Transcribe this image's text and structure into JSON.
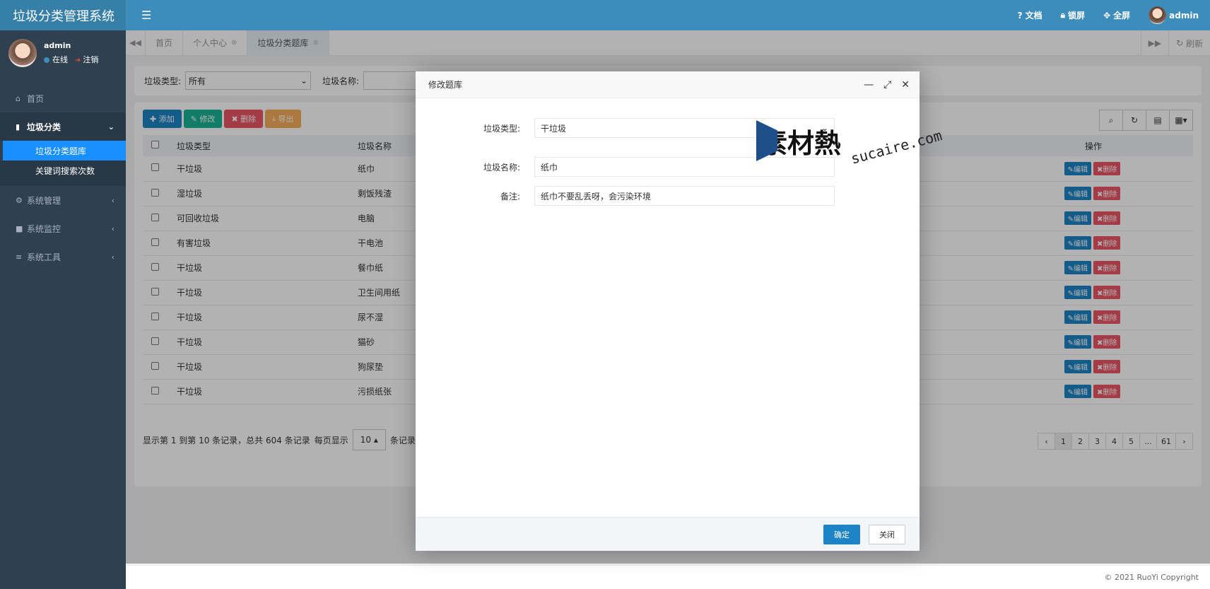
{
  "app": {
    "title": "垃圾分类管理系统"
  },
  "topbar": {
    "docs": "文档",
    "lock": "锁屏",
    "fullscreen": "全屏",
    "username": "admin"
  },
  "user_panel": {
    "name": "admin",
    "online": "在线",
    "logout": "注销"
  },
  "sidebar": {
    "home": "首页",
    "garbage": "垃圾分类",
    "garbage_library": "垃圾分类题库",
    "keyword_stats": "关键词搜索次数",
    "system_manage": "系统管理",
    "system_monitor": "系统监控",
    "system_tools": "系统工具"
  },
  "tabs": {
    "home": "首页",
    "profile": "个人中心",
    "library": "垃圾分类题库",
    "refresh": "刷新"
  },
  "search": {
    "type_label": "垃圾类型:",
    "type_value": "所有",
    "name_label": "垃圾名称:"
  },
  "toolbar": {
    "add": "添加",
    "edit": "修改",
    "delete": "删除",
    "export": "导出"
  },
  "table": {
    "headers": {
      "type": "垃圾类型",
      "name": "垃圾名称",
      "ops": "操作"
    },
    "edit_label": "编辑",
    "delete_label": "删除",
    "rows": [
      {
        "type": "干垃圾",
        "name": "纸巾"
      },
      {
        "type": "湿垃圾",
        "name": "剩饭残渣"
      },
      {
        "type": "可回收垃圾",
        "name": "电脑"
      },
      {
        "type": "有害垃圾",
        "name": "干电池"
      },
      {
        "type": "干垃圾",
        "name": "餐巾纸"
      },
      {
        "type": "干垃圾",
        "name": "卫生间用纸"
      },
      {
        "type": "干垃圾",
        "name": "尿不湿"
      },
      {
        "type": "干垃圾",
        "name": "猫砂"
      },
      {
        "type": "干垃圾",
        "name": "狗尿垫"
      },
      {
        "type": "干垃圾",
        "name": "污损纸张"
      }
    ]
  },
  "pager": {
    "info": "显示第 1 到第 10 条记录，总共 604 条记录",
    "per_page_label": "每页显示",
    "per_page": "10",
    "records": "条记录",
    "pages": [
      "1",
      "2",
      "3",
      "4",
      "5",
      "...",
      "61"
    ]
  },
  "modal": {
    "title": "修改题库",
    "type_label": "垃圾类型:",
    "type_value": "干垃圾",
    "name_label": "垃圾名称:",
    "name_value": "纸巾",
    "remark_label": "备注:",
    "remark_value": "纸巾不要乱丢呀，会污染环境",
    "ok": "确定",
    "close": "关闭"
  },
  "watermark": {
    "brand": "素材熱",
    "url": "sucaire.com"
  },
  "footer": {
    "copyright": "© 2021 RuoYi Copyright"
  },
  "colors": {
    "topbar": "#3c8dbc",
    "sidebar": "#2f4050",
    "active": "#1890ff",
    "primary": "#1c84c6",
    "danger": "#ed5565"
  }
}
